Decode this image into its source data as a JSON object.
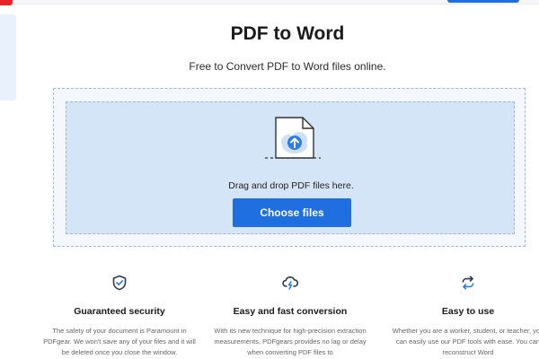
{
  "header": {
    "title": "PDF to Word",
    "subtitle": "Free to Convert PDF to Word files online."
  },
  "upload": {
    "drop_text": "Drag and drop PDF files here.",
    "choose_label": "Choose files"
  },
  "features": [
    {
      "icon": "shield-check-icon",
      "title": "Guaranteed security",
      "desc": "The safety of your document is Paramount in PDFgear. We won't save any of your files and it will be deleted once you close the window."
    },
    {
      "icon": "cloud-lightning-icon",
      "title": "Easy and fast conversion",
      "desc": "With its new technique for high-precision extraction measurements, PDFgears provides no lag or delay when converting PDF files to"
    },
    {
      "icon": "refresh-arrows-icon",
      "title": "Easy to use",
      "desc": "Whether you are a worker, student, or teacher, you can easily use our PDF tools with ease. You can reconstruct Word"
    }
  ],
  "colors": {
    "accent": "#1f6fe0",
    "upload_fill": "#d5e5f8",
    "brand_red": "#e5252a"
  }
}
